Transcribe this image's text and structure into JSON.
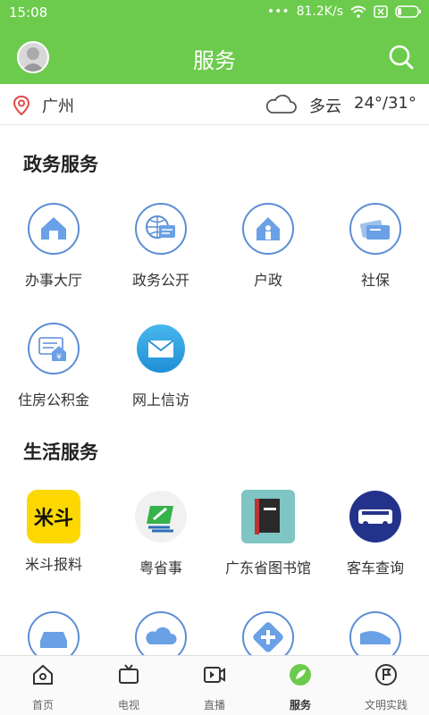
{
  "status_bar": {
    "time": "15:08",
    "network_speed": "81.2K/s"
  },
  "header": {
    "title": "服务"
  },
  "location": {
    "city": "广州",
    "weather": "多云",
    "temperature": "24°/31°"
  },
  "gov_section": {
    "title": "政务服务",
    "items": [
      {
        "label": "办事大厅",
        "icon": "hall-icon"
      },
      {
        "label": "政务公开",
        "icon": "gov-public-icon"
      },
      {
        "label": "户政",
        "icon": "household-icon"
      },
      {
        "label": "社保",
        "icon": "social-security-icon"
      },
      {
        "label": "住房公积金",
        "icon": "housing-fund-icon"
      },
      {
        "label": "网上信访",
        "icon": "mail-icon"
      }
    ]
  },
  "life_section": {
    "title": "生活服务",
    "items": [
      {
        "label": "米斗报料",
        "icon": "midou-logo",
        "logo_text": "米斗"
      },
      {
        "label": "粤省事",
        "icon": "yueshengshi-icon"
      },
      {
        "label": "广东省图书馆",
        "icon": "library-book-icon"
      },
      {
        "label": "客车查询",
        "icon": "bus-icon"
      }
    ]
  },
  "tabs": [
    {
      "label": "首页",
      "icon": "home-icon"
    },
    {
      "label": "电视",
      "icon": "tv-icon"
    },
    {
      "label": "直播",
      "icon": "live-icon"
    },
    {
      "label": "服务",
      "icon": "service-icon",
      "active": true
    },
    {
      "label": "文明实践",
      "icon": "flag-icon"
    }
  ],
  "colors": {
    "brand_green": "#6ccb4c",
    "icon_blue": "#5b8ed6"
  }
}
